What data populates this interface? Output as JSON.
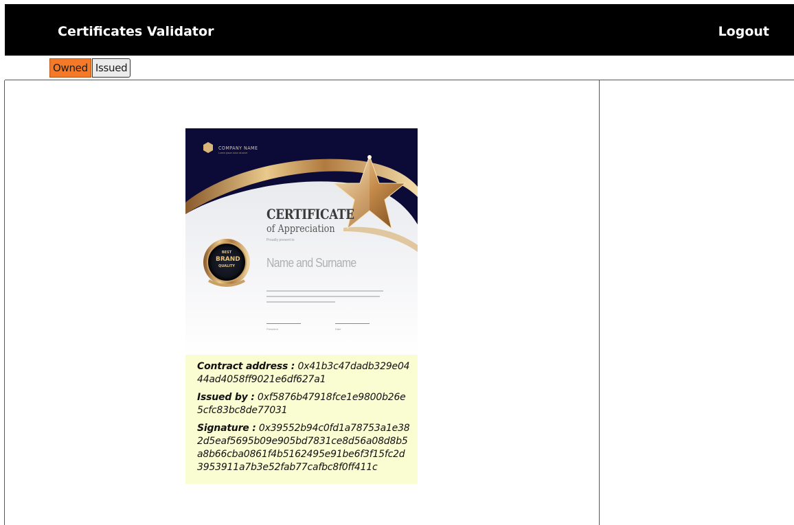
{
  "nav": {
    "certificates": "Certificates",
    "validator": "Validator",
    "logout": "Logout"
  },
  "tabs": [
    {
      "label": "Owned",
      "active": true
    },
    {
      "label": "Issued",
      "active": false
    }
  ],
  "certificate": {
    "image": {
      "company_name": "COMPANY NAME",
      "company_tagline": "Lorem ipsum dolor sit amet",
      "title": "CERTIFICATE",
      "subtitle": "of Appreciation",
      "presented": "Proudly present to",
      "recipient": "Name and Surname",
      "seal_line1": "BEST",
      "seal_line2": "BRAND",
      "seal_line3": "QUALITY",
      "signature_label_left": "President",
      "signature_label_right": "Date"
    },
    "contract_address_label": "Contract address :",
    "contract_address": "0x41b3c47dadb329e0444ad4058ff9021e6df627a1",
    "issued_by_label": "Issued by :",
    "issued_by": "0xf5876b47918fce1e9800b26e5cfc83bc8de77031",
    "signature_label": "Signature :",
    "signature": "0x39552b94c0fd1a78753a1e382d5eaf5695b09e905bd7831ce8d56a08d8b5a8b66cba0861f4b5162495e91be6f3f15fc2d3953911a7b3e52fab77cafbc8f0ff411c"
  },
  "colors": {
    "topbar": "#000000",
    "active_tab": "#f47a2a",
    "details_background": "#fafcd2",
    "certificate_navy": "#0c0a36",
    "gold": "#c9a063"
  }
}
